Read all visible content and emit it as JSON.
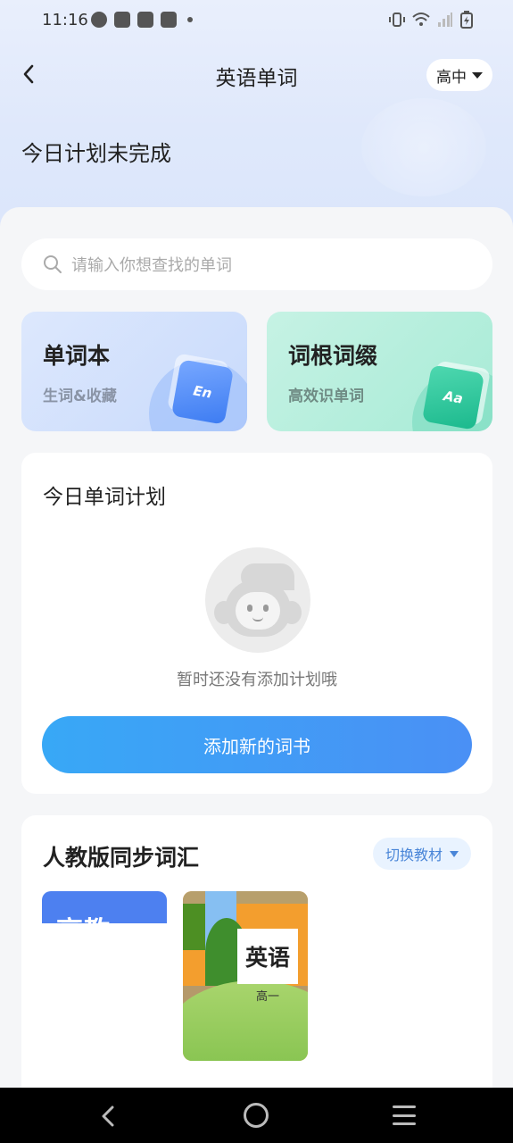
{
  "status_bar": {
    "time": "11:16",
    "left_icons": [
      "speedometer-icon",
      "shopping-bag-icon",
      "shopping-bag-icon",
      "shopping-bag-icon",
      "dot-icon"
    ],
    "right_icons": [
      "vibrate-icon",
      "wifi-icon",
      "signal-icon",
      "battery-charging-icon"
    ]
  },
  "header": {
    "title": "英语单词",
    "grade_selected": "高中"
  },
  "plan_status": "今日计划未完成",
  "search": {
    "placeholder": "请输入你想查找的单词"
  },
  "feature_cards": [
    {
      "title": "单词本",
      "subtitle": "生词&收藏",
      "icon_text": "En",
      "icon": "en-book-icon"
    },
    {
      "title": "词根词缀",
      "subtitle": "高效识单词",
      "icon_text": "Aa",
      "icon": "aa-book-icon"
    }
  ],
  "today_plan": {
    "title": "今日单词计划",
    "empty_text": "暂时还没有添加计划哦",
    "add_button": "添加新的词书"
  },
  "sync_vocab": {
    "title": "人教版同步词汇",
    "switch_button": "切换教材",
    "books": [
      {
        "cover_text": "高教"
      },
      {
        "cover_title": "英语",
        "cover_grade": "高一"
      }
    ]
  },
  "colors": {
    "accent_blue": "#4a90f5",
    "button_gradient_start": "#38a8f6",
    "vocab_card_bg": "#c8dafc",
    "root_card_bg": "#a7ebd6"
  }
}
